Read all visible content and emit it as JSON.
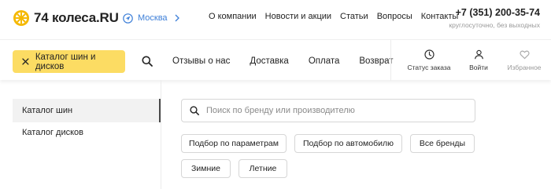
{
  "header": {
    "logo_text": "74 колеса.RU",
    "city": "Москва",
    "nav": [
      "О компании",
      "Новости и акции",
      "Статьи",
      "Вопросы",
      "Контакты"
    ],
    "phone": "+7 (351) 200-35-74",
    "phone_note": "круглосуточно, без выходных"
  },
  "navbar": {
    "catalog_button": "Каталог шин и дисков",
    "menu": [
      "Отзывы о нас",
      "Доставка",
      "Оплата",
      "Возврат"
    ],
    "order_status": "Статус заказа",
    "login": "Войти",
    "favorites": "Избранное"
  },
  "sidebar": {
    "items": [
      {
        "label": "Каталог шин",
        "active": true
      },
      {
        "label": "Каталог дисков",
        "active": false
      }
    ]
  },
  "main": {
    "search_placeholder": "Поиск по бренду или производителю",
    "filters_row1": [
      "Подбор по параметрам",
      "Подбор по автомобилю",
      "Все бренды"
    ],
    "filters_row2": [
      "Зимние",
      "Летние"
    ]
  },
  "colors": {
    "accent_yellow": "#fcdc63",
    "link_blue": "#3d7fd8",
    "logo_yellow": "#f5b800"
  },
  "icons": [
    "wheel-logo-icon",
    "location-pin-icon",
    "chevron-right-icon",
    "close-icon",
    "search-icon",
    "clock-icon",
    "user-icon",
    "heart-icon"
  ]
}
